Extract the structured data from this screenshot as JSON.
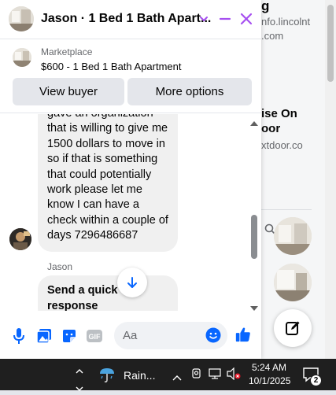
{
  "background": {
    "lines": [
      "g",
      "nfo.lincolnt",
      ".com",
      "ise On",
      "oor",
      "xtdoor.co"
    ]
  },
  "chat": {
    "title": "Jason · 1 Bed 1 Bath Apart...",
    "listing": {
      "label": "Marketplace",
      "title": "$600 - 1 Bed 1 Bath Apartment",
      "view_buyer": "View buyer",
      "more_options": "More options"
    },
    "message_text": "gave an organization that is willing to give me 1500 dollars to move in so if that is something that could potentially work please let me know I can have a check within a couple of days 7296486687",
    "sender_name": "Jason",
    "quick_response": "Send a quick response",
    "composer_placeholder": "Aa",
    "accent": "#a64ff0",
    "blue": "#0866ff"
  },
  "taskbar": {
    "weather_label": "Rain...",
    "time": "5:24 AM",
    "date": "10/1/2025",
    "notification_count": "2"
  }
}
